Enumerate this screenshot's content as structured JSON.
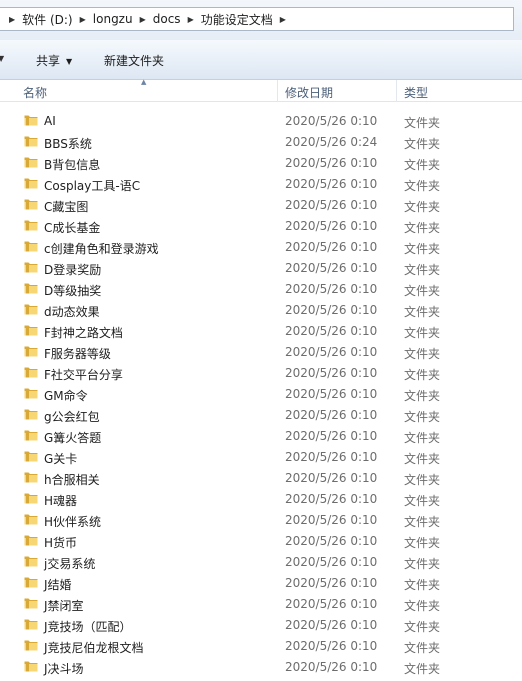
{
  "address": {
    "crumbs": [
      "软件 (D:)",
      "longzu",
      "docs",
      "功能设定文档"
    ]
  },
  "toolbar": {
    "share_label": "共享",
    "new_folder_label": "新建文件夹"
  },
  "columns": {
    "name": "名称",
    "date": "修改日期",
    "type": "类型"
  },
  "files": [
    {
      "name": "AI",
      "date": "2020/5/26 0:10",
      "type": "文件夹"
    },
    {
      "name": "BBS系统",
      "date": "2020/5/26 0:24",
      "type": "文件夹"
    },
    {
      "name": "B背包信息",
      "date": "2020/5/26 0:10",
      "type": "文件夹"
    },
    {
      "name": "Cosplay工具-语C",
      "date": "2020/5/26 0:10",
      "type": "文件夹"
    },
    {
      "name": "C藏宝图",
      "date": "2020/5/26 0:10",
      "type": "文件夹"
    },
    {
      "name": "C成长基金",
      "date": "2020/5/26 0:10",
      "type": "文件夹"
    },
    {
      "name": "c创建角色和登录游戏",
      "date": "2020/5/26 0:10",
      "type": "文件夹"
    },
    {
      "name": "D登录奖励",
      "date": "2020/5/26 0:10",
      "type": "文件夹"
    },
    {
      "name": "D等级抽奖",
      "date": "2020/5/26 0:10",
      "type": "文件夹"
    },
    {
      "name": "d动态效果",
      "date": "2020/5/26 0:10",
      "type": "文件夹"
    },
    {
      "name": "F封神之路文档",
      "date": "2020/5/26 0:10",
      "type": "文件夹"
    },
    {
      "name": "F服务器等级",
      "date": "2020/5/26 0:10",
      "type": "文件夹"
    },
    {
      "name": "F社交平台分享",
      "date": "2020/5/26 0:10",
      "type": "文件夹"
    },
    {
      "name": "GM命令",
      "date": "2020/5/26 0:10",
      "type": "文件夹"
    },
    {
      "name": "g公会红包",
      "date": "2020/5/26 0:10",
      "type": "文件夹"
    },
    {
      "name": "G篝火答题",
      "date": "2020/5/26 0:10",
      "type": "文件夹"
    },
    {
      "name": "G关卡",
      "date": "2020/5/26 0:10",
      "type": "文件夹"
    },
    {
      "name": "h合服相关",
      "date": "2020/5/26 0:10",
      "type": "文件夹"
    },
    {
      "name": "H魂器",
      "date": "2020/5/26 0:10",
      "type": "文件夹"
    },
    {
      "name": "H伙伴系统",
      "date": "2020/5/26 0:10",
      "type": "文件夹"
    },
    {
      "name": "H货币",
      "date": "2020/5/26 0:10",
      "type": "文件夹"
    },
    {
      "name": "j交易系统",
      "date": "2020/5/26 0:10",
      "type": "文件夹"
    },
    {
      "name": "J结婚",
      "date": "2020/5/26 0:10",
      "type": "文件夹"
    },
    {
      "name": "J禁闭室",
      "date": "2020/5/26 0:10",
      "type": "文件夹"
    },
    {
      "name": "J竞技场（匹配）",
      "date": "2020/5/26 0:10",
      "type": "文件夹"
    },
    {
      "name": "J竞技尼伯龙根文档",
      "date": "2020/5/26 0:10",
      "type": "文件夹"
    },
    {
      "name": "J决斗场",
      "date": "2020/5/26 0:10",
      "type": "文件夹"
    }
  ],
  "colors": {
    "folder_light": "#f7d774",
    "folder_dark": "#d9a937",
    "header_text": "#4c607a"
  }
}
